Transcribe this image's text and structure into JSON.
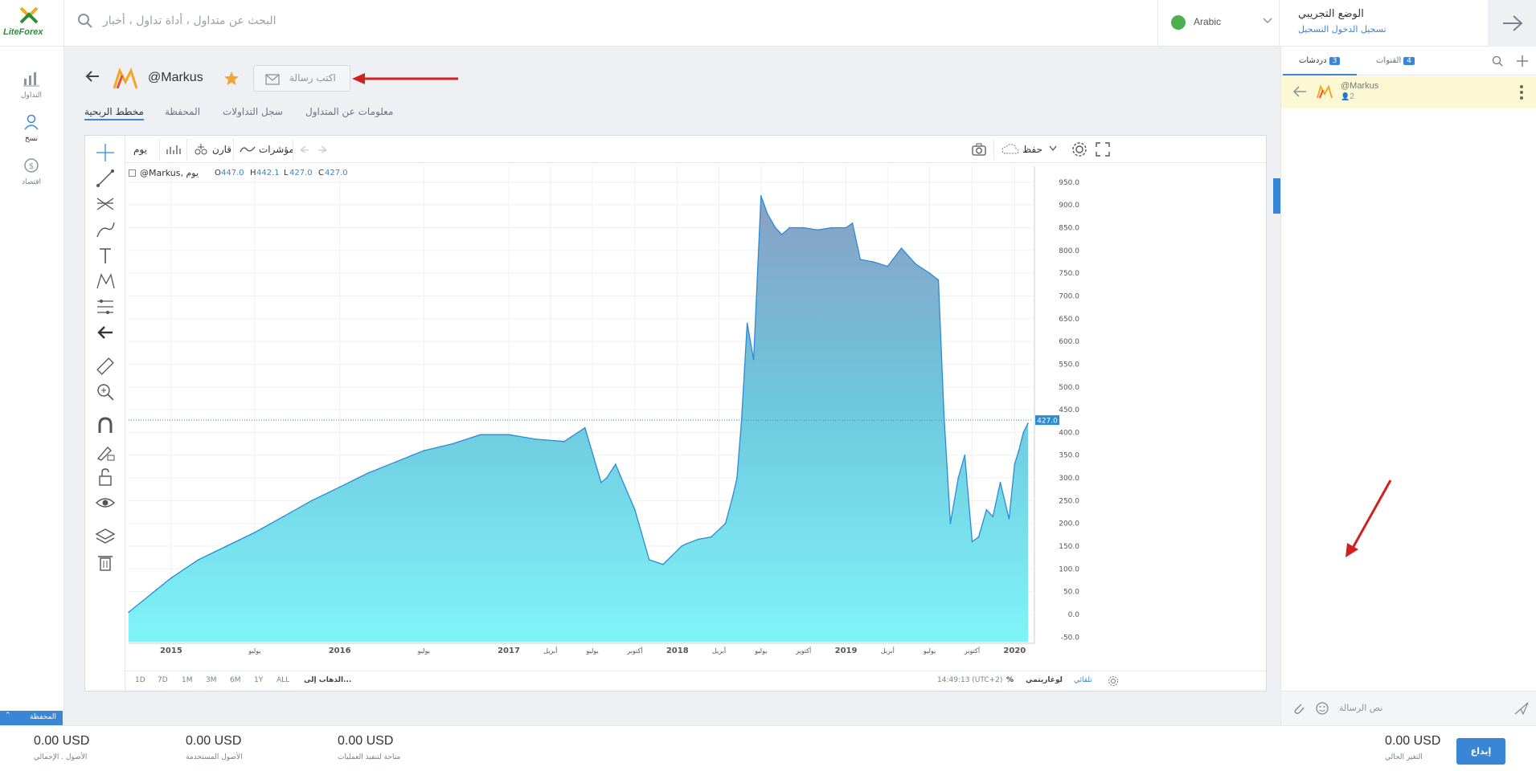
{
  "topbar": {
    "logo_text": "LiteForex",
    "search_placeholder": "البحث عن متداول ، أداة تداول ، أخبار",
    "language": "Arabic",
    "account_title": "الوضع التجريبي",
    "account_login": "تسجيل الدخول التسجيل"
  },
  "leftnav": {
    "items": [
      {
        "label": "التداول",
        "icon": "chart-bars-icon"
      },
      {
        "label": "نسخ",
        "icon": "copy-trader-icon"
      },
      {
        "label": "اقتصاد",
        "icon": "dollar-circle-icon"
      }
    ],
    "portfolio_tab": "المحفظة"
  },
  "trader": {
    "name": "@Markus",
    "write_message": "اكتب رسالة",
    "tabs": [
      "مخطط الربحية",
      "المحفظة",
      "سجل التداولات",
      "معلومات عن المتداول"
    ],
    "active_tab": 0
  },
  "chart_toolbar": {
    "interval": "يوم",
    "chart_type_label": "قارن",
    "indicators_label": "مؤشرات",
    "save_label": "حفظ"
  },
  "legend": {
    "symbol": "@Markus, يوم",
    "o_label": "O",
    "o_value": "447.0",
    "h_label": "H",
    "h_value": "442.1",
    "l_label": "L",
    "l_value": "427.0",
    "c_label": "C",
    "c_value": "427.0"
  },
  "bottom_toolbar": {
    "ranges": [
      "1D",
      "7D",
      "1M",
      "3M",
      "6M",
      "1Y",
      "ALL"
    ],
    "goto": "الذهاب إلى...",
    "time": "14:49:13 (UTC+2)",
    "percent": "%",
    "log": "لوغاريتمي",
    "auto": "تلقائي"
  },
  "chart_data": {
    "type": "area",
    "title": "",
    "xlabel": "",
    "ylabel": "",
    "ylim": [
      -60,
      985
    ],
    "y_ticks": [
      "950.0",
      "900.0",
      "850.0",
      "800.0",
      "750.0",
      "700.0",
      "650.0",
      "600.0",
      "550.0",
      "500.0",
      "450.0",
      "400.0",
      "350.0",
      "300.0",
      "250.0",
      "200.0",
      "150.0",
      "100.0",
      "50.0",
      "0.0",
      "-50.0"
    ],
    "x_ticks": [
      {
        "label": "2015",
        "bold": true
      },
      {
        "label": "يوليو",
        "bold": false
      },
      {
        "label": "2016",
        "bold": true
      },
      {
        "label": "يوليو",
        "bold": false
      },
      {
        "label": "2017",
        "bold": true
      },
      {
        "label": "أبريل",
        "bold": false
      },
      {
        "label": "يوليو",
        "bold": false
      },
      {
        "label": "أكتوبر",
        "bold": false
      },
      {
        "label": "2018",
        "bold": true
      },
      {
        "label": "أبريل",
        "bold": false
      },
      {
        "label": "يوليو",
        "bold": false
      },
      {
        "label": "أكتوبر",
        "bold": false
      },
      {
        "label": "2019",
        "bold": true
      },
      {
        "label": "أبريل",
        "bold": false
      },
      {
        "label": "يوليو",
        "bold": false
      },
      {
        "label": "أكتوبر",
        "bold": false
      },
      {
        "label": "2020",
        "bold": true
      }
    ],
    "last_value": "427.0",
    "series": [
      {
        "x": [
          "2014-10-01",
          "2014-11-01",
          "2014-12-01",
          "2015-01-01",
          "2015-03-01",
          "2015-05-01",
          "2015-07-01",
          "2015-09-01",
          "2015-11-01",
          "2016-01-01",
          "2016-03-01",
          "2016-05-01",
          "2016-07-01",
          "2016-09-01",
          "2016-11-01",
          "2017-01-01",
          "2017-03-01",
          "2017-05-01",
          "2017-06-15",
          "2017-07-20",
          "2017-08-01",
          "2017-08-20",
          "2017-09-10",
          "2017-10-01",
          "2017-10-15",
          "2017-11-01",
          "2017-12-01",
          "2018-01-10",
          "2018-01-20",
          "2018-02-15",
          "2018-03-15",
          "2018-04-15",
          "2018-05-01",
          "2018-05-10",
          "2018-05-20",
          "2018-06-01",
          "2018-06-15",
          "2018-07-01",
          "2018-07-15",
          "2018-08-01",
          "2018-08-15",
          "2018-09-01",
          "2018-10-01",
          "2018-11-01",
          "2018-12-01",
          "2019-01-01",
          "2019-01-15",
          "2019-02-01",
          "2019-03-01",
          "2019-04-01",
          "2019-05-01",
          "2019-06-01",
          "2019-07-01",
          "2019-07-20",
          "2019-08-01",
          "2019-08-15",
          "2019-09-01",
          "2019-09-15",
          "2019-10-01",
          "2019-10-15",
          "2019-11-01",
          "2019-11-15",
          "2019-12-01",
          "2019-12-20",
          "2020-01-01",
          "2020-01-10",
          "2020-01-20",
          "2020-01-30"
        ],
        "values": [
          5,
          30,
          55,
          80,
          120,
          150,
          180,
          215,
          250,
          280,
          310,
          335,
          360,
          375,
          395,
          395,
          385,
          380,
          410,
          290,
          300,
          330,
          280,
          230,
          180,
          120,
          110,
          150,
          155,
          165,
          170,
          200,
          260,
          300,
          430,
          640,
          560,
          920,
          880,
          850,
          835,
          850,
          850,
          845,
          850,
          850,
          860,
          780,
          775,
          765,
          805,
          770,
          750,
          735,
          440,
          200,
          300,
          350,
          160,
          170,
          230,
          215,
          290,
          210,
          330,
          360,
          400,
          420
        ]
      }
    ]
  },
  "rightpanel": {
    "tabs": [
      {
        "label": "دردشات",
        "count": "3"
      },
      {
        "label": "القنوات",
        "count": "4"
      }
    ],
    "chat_name": "@Markus",
    "chat_members": "2",
    "message_placeholder": "نص الرسالة"
  },
  "footer": {
    "items": [
      {
        "value": "0.00 USD",
        "label": "الأصول . الإجمالي"
      },
      {
        "value": "0.00 USD",
        "label": "الأصول المستخدمة"
      },
      {
        "value": "0.00 USD",
        "label": "متاحة لتنفيذ العمليات"
      }
    ],
    "current_change_value": "0.00 USD",
    "current_change_label": "التغير الحالي",
    "deposit_label": "إيداع"
  }
}
